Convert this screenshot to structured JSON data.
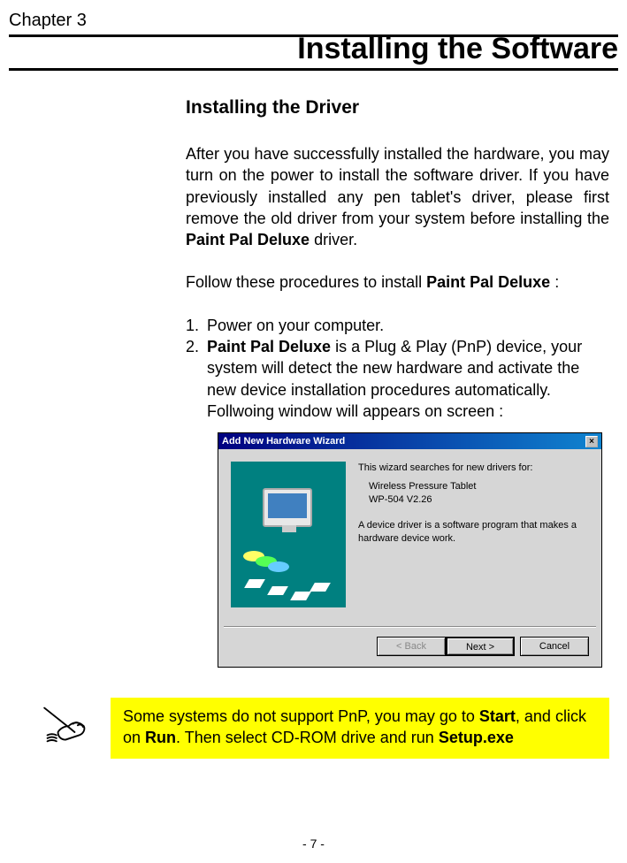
{
  "chapter": {
    "label": "Chapter 3",
    "title": "Installing the Software"
  },
  "section": {
    "heading": "Installing the Driver",
    "intro_parts": {
      "p1": "After you have successfully installed the hardware, you may turn on the power to install the software driver.  If you have previously installed any pen tablet's driver, please first remove the old driver from your system before installing the ",
      "p1_bold": "Paint Pal Deluxe",
      "p1_end": " driver.",
      "p2_pre": "Follow these procedures to install ",
      "p2_bold": "Paint Pal Deluxe",
      "p2_end": " :"
    },
    "steps": {
      "s1_num": "1.",
      "s1_text": "Power on your computer.",
      "s2_num": "2.",
      "s2_bold": "Paint Pal Deluxe",
      "s2_rest": " is a Plug & Play (PnP) device, your system will detect the new hardware and activate the new device installation procedures automatically. Follwoing window will appears on screen :"
    }
  },
  "wizard": {
    "title": "Add New Hardware Wizard",
    "line1": "This wizard searches for new drivers for:",
    "device1": "Wireless Pressure Tablet",
    "device2": "WP-504 V2.26",
    "line2": "A device driver is a software program that makes a hardware device work.",
    "btn_back": "< Back",
    "btn_next": "Next >",
    "btn_cancel": "Cancel"
  },
  "note": {
    "t1": "Some systems do not support PnP, you may go to ",
    "b1": "Start",
    "t2": ", and click on ",
    "b2": "Run",
    "t3": ". Then select CD-ROM drive and run ",
    "b3": "Setup.exe"
  },
  "page_number": "- 7 -"
}
